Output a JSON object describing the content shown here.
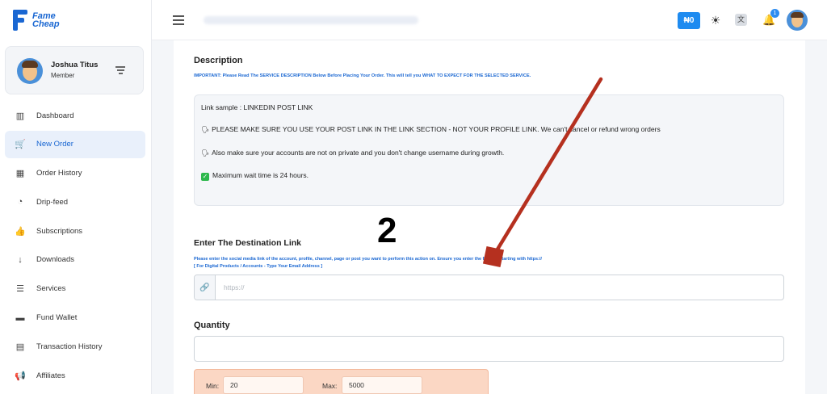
{
  "brand": {
    "logo_text_line1": "Fame",
    "logo_text_line2": "Cheap",
    "accent": "#1a67d2"
  },
  "user": {
    "name": "Joshua Titus",
    "role": "Member"
  },
  "sidebar": {
    "items": [
      {
        "label": "Dashboard",
        "icon": "chart-bars-icon",
        "glyph": "▥",
        "active": false
      },
      {
        "label": "New Order",
        "icon": "cart-icon",
        "glyph": "🛒",
        "active": true
      },
      {
        "label": "Order History",
        "icon": "calendar-icon",
        "glyph": "▦",
        "active": false
      },
      {
        "label": "Drip-feed",
        "icon": "clock-icon",
        "glyph": "◔",
        "active": false
      },
      {
        "label": "Subscriptions",
        "icon": "thumbs-up-icon",
        "glyph": "👍",
        "active": false
      },
      {
        "label": "Downloads",
        "icon": "arrow-down-icon",
        "glyph": "↓",
        "active": false
      },
      {
        "label": "Services",
        "icon": "list-icon",
        "glyph": "☰",
        "active": false
      },
      {
        "label": "Fund Wallet",
        "icon": "wallet-icon",
        "glyph": "▬",
        "active": false
      },
      {
        "label": "Transaction History",
        "icon": "receipt-icon",
        "glyph": "▤",
        "active": false
      },
      {
        "label": "Affiliates",
        "icon": "megaphone-icon",
        "glyph": "📢",
        "active": false
      }
    ]
  },
  "topbar": {
    "balance": "₦0",
    "notification_count": "1",
    "balance_color": "#1e8bf0"
  },
  "description": {
    "title": "Description",
    "warning": "IMPORTANT: Please Read The SERVICE DESCRIPTION Below Before Placing Your Order. This will tell you WHAT TO EXPECT FOR THE SELECTED SERVICE.",
    "lines": [
      "Link sample : LINKEDIN POST LINK",
      "PLEASE MAKE SURE YOU USE YOUR POST LINK IN THE LINK SECTION - NOT YOUR PROFILE LINK. We can't cancel or refund wrong orders",
      "Also make sure your accounts are not on private and you don't change username during growth.",
      "Maximum wait time is 24 hours."
    ]
  },
  "annotation": {
    "step": "2",
    "arrow_color": "#b5301f"
  },
  "destination": {
    "title": "Enter The Destination Link",
    "help_line1": "Please enter the social media link of the account, profile, channel, page or post you want to perform this action on. Ensure you enter the full link starting with https://",
    "help_line2": "[ For Digital Products / Accounts - Type Your Email Address ]",
    "placeholder": "https://"
  },
  "quantity": {
    "title": "Quantity",
    "min_label": "Min:",
    "min_value": "20",
    "max_label": "Max:",
    "max_value": "5000"
  }
}
